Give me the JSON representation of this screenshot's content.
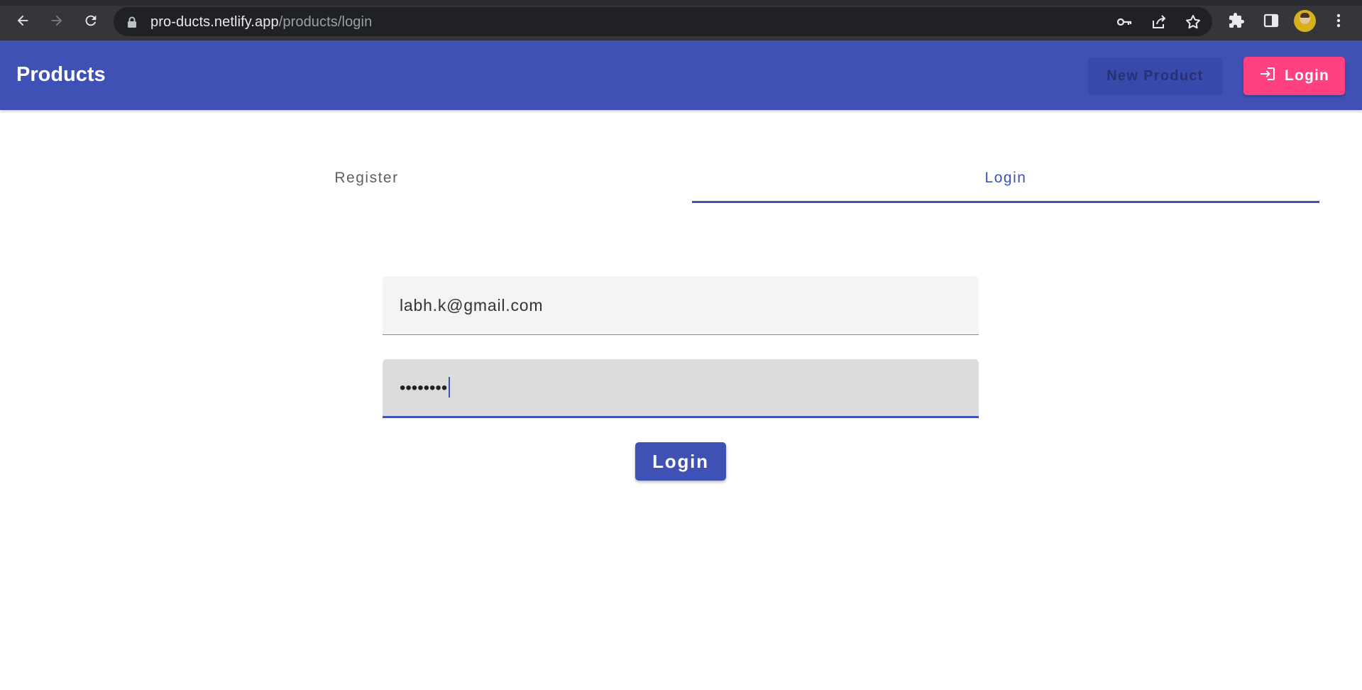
{
  "browser": {
    "url_host": "pro-ducts.netlify.app",
    "url_path": "/products/login",
    "icons": [
      "back-icon",
      "forward-icon",
      "reload-icon",
      "lock-icon",
      "key-icon",
      "share-icon",
      "star-icon",
      "extensions-icon",
      "side-panel-icon",
      "avatar",
      "menu-icon"
    ]
  },
  "toolbar": {
    "title": "Products",
    "new_product_label": "New Product",
    "login_label": "Login",
    "login_icon": "login-icon"
  },
  "tabs": [
    {
      "label": "Register",
      "active": false
    },
    {
      "label": "Login",
      "active": true
    }
  ],
  "form": {
    "email_value": "labh.k@gmail.com",
    "password_value": "••••••••",
    "submit_label": "Login"
  },
  "colors": {
    "primary": "#3f51b5",
    "accent": "#ff4081",
    "browser_frame": "#35363a"
  }
}
